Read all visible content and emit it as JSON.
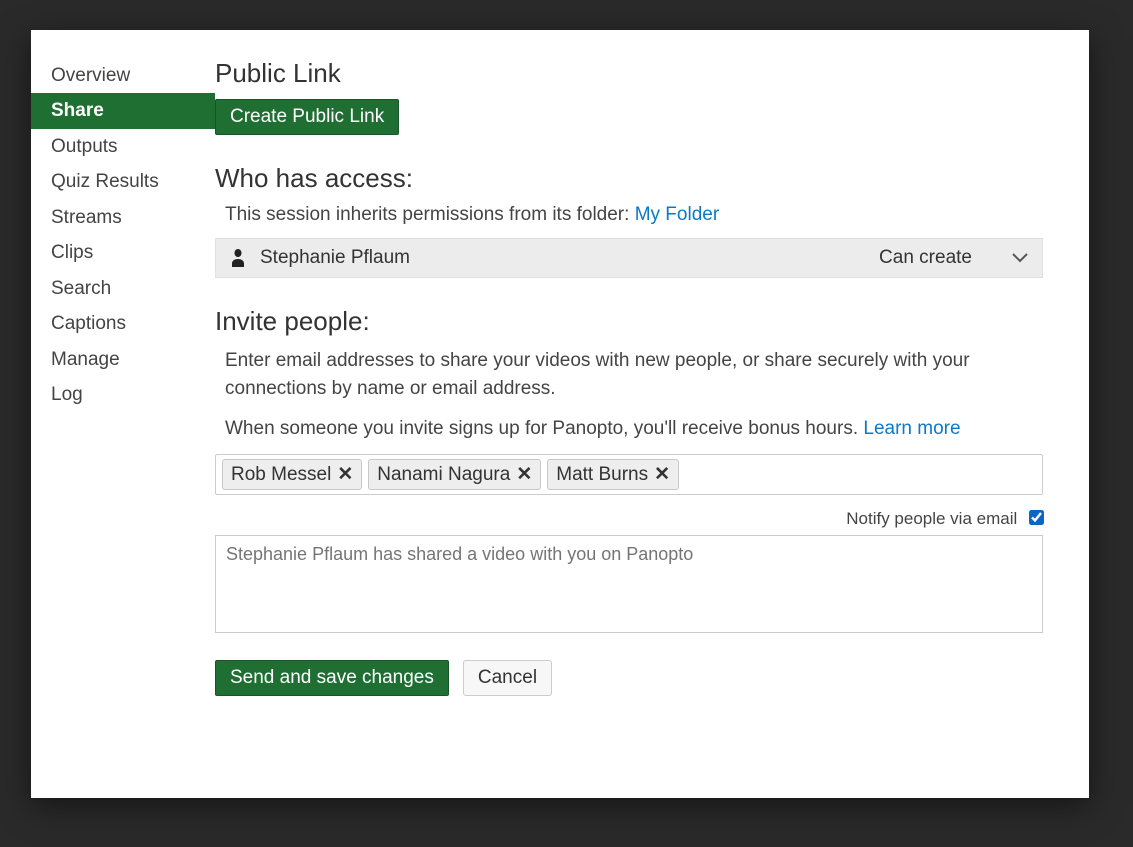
{
  "sidebar": {
    "items": [
      {
        "label": "Overview"
      },
      {
        "label": "Share"
      },
      {
        "label": "Outputs"
      },
      {
        "label": "Quiz Results"
      },
      {
        "label": "Streams"
      },
      {
        "label": "Clips"
      },
      {
        "label": "Search"
      },
      {
        "label": "Captions"
      },
      {
        "label": "Manage"
      },
      {
        "label": "Log"
      }
    ],
    "activeIndex": 1
  },
  "publicLink": {
    "heading": "Public Link",
    "createButton": "Create Public Link"
  },
  "access": {
    "heading": "Who has access:",
    "inheritPrefix": "This session inherits permissions from its folder: ",
    "folderLink": "My Folder",
    "rows": [
      {
        "name": "Stephanie Pflaum",
        "permission": "Can create"
      }
    ]
  },
  "invite": {
    "heading": "Invite people:",
    "description": "Enter email addresses to share your videos with new people, or share securely with your connections by name or email address.",
    "bonusText": "When someone you invite signs up for Panopto, you'll receive bonus hours.  ",
    "learnMore": "Learn more",
    "tokens": [
      "Rob Messel",
      "Nanami Nagura",
      "Matt Burns"
    ],
    "notifyLabel": "Notify people via email",
    "notifyChecked": true,
    "messagePlaceholder": "Stephanie Pflaum has shared a video with you on Panopto"
  },
  "actions": {
    "sendSave": "Send and save changes",
    "cancel": "Cancel"
  }
}
